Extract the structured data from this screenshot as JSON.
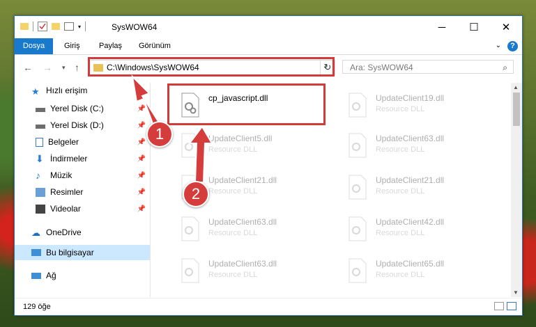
{
  "window": {
    "title": "SysWOW64"
  },
  "ribbon": {
    "tabs": [
      "Dosya",
      "Giriş",
      "Paylaş",
      "Görünüm"
    ]
  },
  "address": {
    "path": "C:\\Windows\\SysWOW64"
  },
  "search": {
    "placeholder": "Ara: SysWOW64"
  },
  "sidebar": {
    "items": [
      {
        "label": "Hızlı erişim",
        "icon": "star-icon",
        "pinned": false
      },
      {
        "label": "Yerel Disk (C:)",
        "icon": "drive-icon",
        "pinned": true
      },
      {
        "label": "Yerel Disk (D:)",
        "icon": "drive-icon",
        "pinned": true
      },
      {
        "label": "Belgeler",
        "icon": "documents-icon",
        "pinned": true
      },
      {
        "label": "İndirmeler",
        "icon": "download-icon",
        "pinned": true
      },
      {
        "label": "Müzik",
        "icon": "music-icon",
        "pinned": true
      },
      {
        "label": "Resimler",
        "icon": "pictures-icon",
        "pinned": true
      },
      {
        "label": "Videolar",
        "icon": "video-icon",
        "pinned": true
      },
      {
        "label": "OneDrive",
        "icon": "cloud-icon",
        "pinned": false
      },
      {
        "label": "Bu bilgisayar",
        "icon": "computer-icon",
        "pinned": false,
        "selected": true
      },
      {
        "label": "Ağ",
        "icon": "network-icon",
        "pinned": false
      }
    ]
  },
  "files": [
    {
      "name": "cp_javascript.dll",
      "type": ""
    },
    {
      "name": "UpdateClient19.dll",
      "type": "Resource DLL"
    },
    {
      "name": "UpdateClient5.dll",
      "type": "Resource DLL"
    },
    {
      "name": "UpdateClient63.dll",
      "type": "Resource DLL"
    },
    {
      "name": "UpdateClient21.dll",
      "type": "Resource DLL"
    },
    {
      "name": "UpdateClient21.dll",
      "type": "Resource DLL"
    },
    {
      "name": "UpdateClient63.dll",
      "type": "Resource DLL"
    },
    {
      "name": "UpdateClient42.dll",
      "type": "Resource DLL"
    },
    {
      "name": "UpdateClient63.dll",
      "type": "Resource DLL"
    },
    {
      "name": "UpdateClient65.dll",
      "type": "Resource DLL"
    }
  ],
  "status": {
    "count": "129 öğe"
  },
  "badges": {
    "one": "1",
    "two": "2"
  },
  "colors": {
    "accent": "#1979ca",
    "highlight": "#d33b3b"
  }
}
